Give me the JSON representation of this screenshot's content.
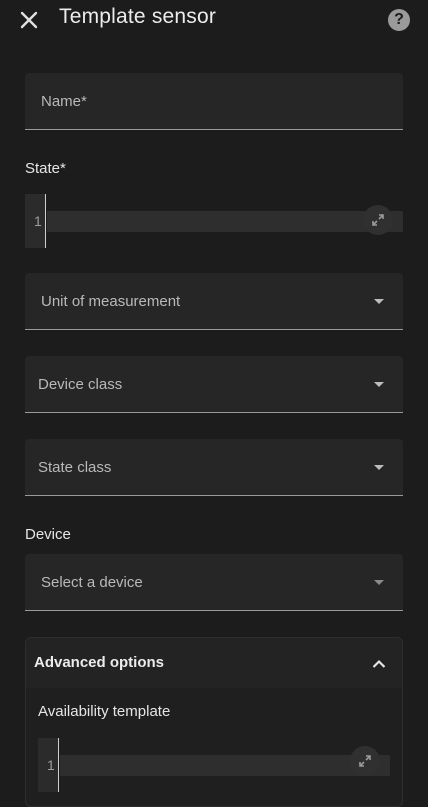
{
  "header": {
    "title": "Template sensor",
    "close_icon": "close-icon",
    "help_icon": "help-icon",
    "help_glyph": "?"
  },
  "form": {
    "name_label": "Name*",
    "state_label": "State*",
    "state_editor_line": "1",
    "unit_label": "Unit of measurement",
    "device_class_label": "Device class",
    "state_class_label": "State class",
    "device_section_label": "Device",
    "device_placeholder": "Select a device"
  },
  "advanced": {
    "title": "Advanced options",
    "availability_label": "Availability template",
    "availability_editor_line": "1"
  },
  "colors": {
    "background": "#1c1c1c",
    "field": "#262626",
    "text": "#e1e1e1"
  }
}
